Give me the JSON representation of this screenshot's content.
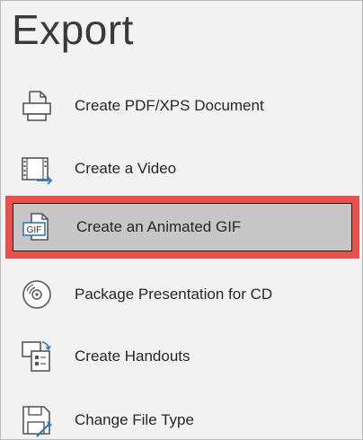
{
  "panel": {
    "title": "Export"
  },
  "menu": {
    "items": [
      {
        "label": "Create PDF/XPS Document",
        "icon": "pdf-document-icon"
      },
      {
        "label": "Create a Video",
        "icon": "video-icon"
      },
      {
        "label": "Create an Animated GIF",
        "icon": "gif-icon",
        "icon_text": "GIF",
        "selected": true
      },
      {
        "label": "Package Presentation for CD",
        "icon": "cd-icon"
      },
      {
        "label": "Create Handouts",
        "icon": "handouts-icon"
      },
      {
        "label": "Change File Type",
        "icon": "change-file-type-icon"
      }
    ]
  },
  "colors": {
    "highlight_border": "#e8504b",
    "selected_background": "#c6c6c6",
    "panel_background": "#f2f2f2",
    "accent_blue": "#2b78c5"
  }
}
